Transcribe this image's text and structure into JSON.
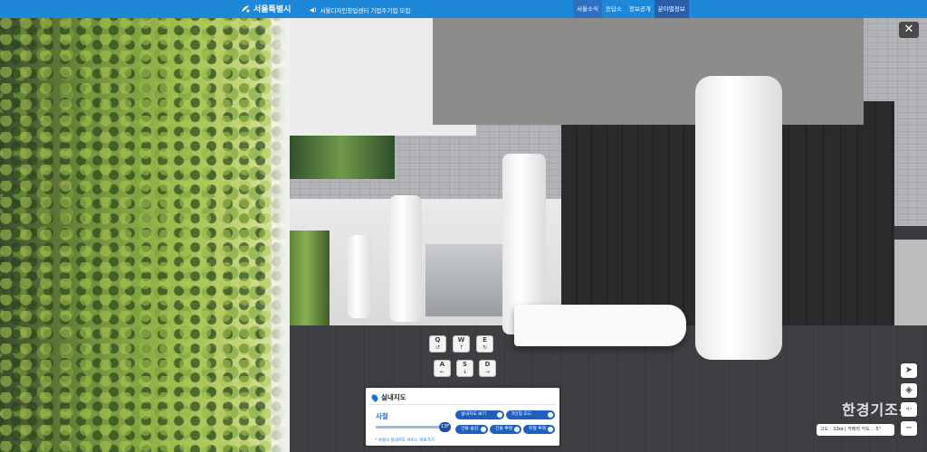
{
  "topbar": {
    "logo_text": "서울특별시",
    "notice_icon": "speaker-icon",
    "notice": "서울디자인창업센터 기업주기업 모집",
    "nav": [
      "서울소식",
      "응답소",
      "정보공개",
      "분야별정보"
    ]
  },
  "close_label": "✕",
  "keys": [
    {
      "letter": "Q",
      "sub": "↺"
    },
    {
      "letter": "W",
      "sub": "↑"
    },
    {
      "letter": "E",
      "sub": "↻"
    },
    {
      "letter": "A",
      "sub": "←"
    },
    {
      "letter": "S",
      "sub": "↓"
    },
    {
      "letter": "D",
      "sub": "→"
    }
  ],
  "panel": {
    "title": "실내지도",
    "season": "사철",
    "slider_value": "13F",
    "slider_fraction": 0.95,
    "link": "* 서울시 실내지도 서비스 바로가기",
    "toggles": [
      "실내지도 보기",
      "3인칭 모드",
      "건물 숨김",
      "건물 투명",
      "지형 투명"
    ]
  },
  "tools": {
    "locate_icon": "location-arrow-icon",
    "compass_icon": "compass-icon",
    "zoom_in": "+",
    "zoom_out": "−"
  },
  "status": "고도 : 32㎞ | 카메라 각도 : -5°",
  "watermark": "한경기조선"
}
